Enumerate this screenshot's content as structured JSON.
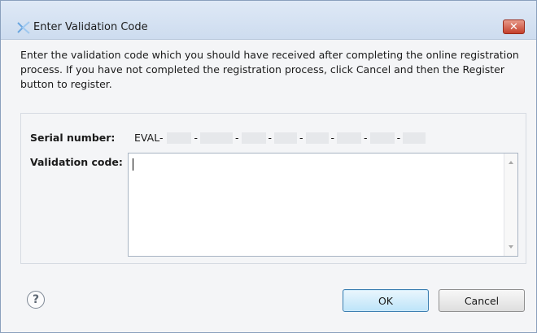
{
  "window": {
    "title": "Enter Validation Code",
    "close_glyph": "✕"
  },
  "description": "Enter the validation code which you should have received after completing the online registration process. If you have not completed the registration process, click Cancel and then the Register button to register.",
  "form": {
    "serial_label": "Serial number:",
    "serial_prefix": "EVAL-",
    "serial_separator": "-",
    "validation_label": "Validation code:",
    "validation_value": ""
  },
  "buttons": {
    "help_glyph": "?",
    "ok_label": "OK",
    "cancel_label": "Cancel"
  },
  "icons": {
    "app": "app-icon",
    "help": "help-icon",
    "close": "close-icon"
  },
  "colors": {
    "accent": "#3c7fb1",
    "close": "#c4402c"
  }
}
